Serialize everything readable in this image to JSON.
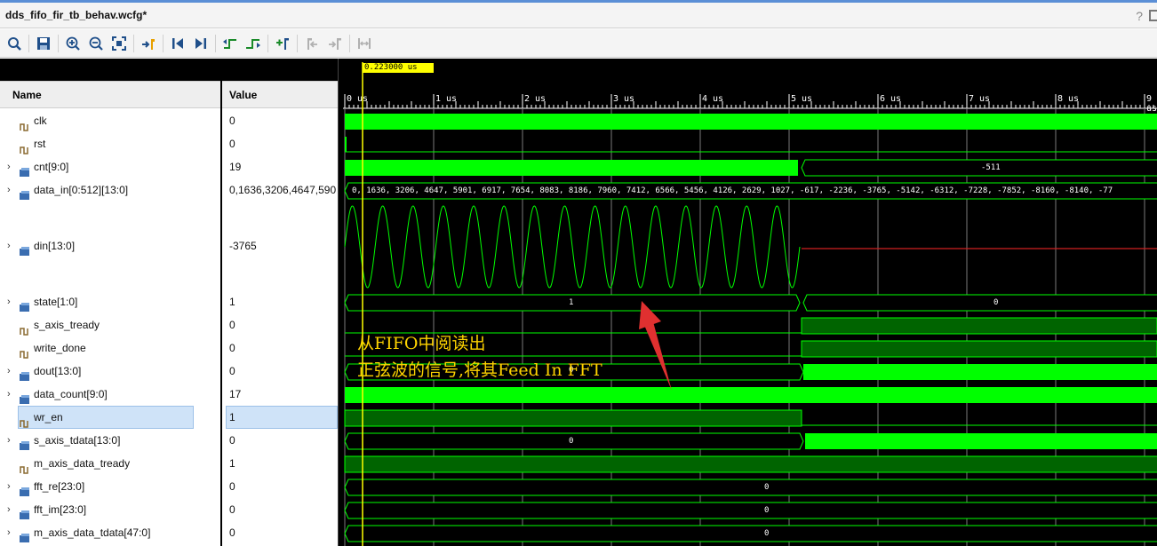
{
  "window": {
    "title": "dds_fifo_fir_tb_behav.wcfg*",
    "help_icon": "?"
  },
  "toolbar": {
    "buttons": [
      "search-icon",
      "save-icon",
      "zoom-in-icon",
      "zoom-out-icon",
      "zoom-fit-icon",
      "goto-cursor-icon",
      "goto-start-icon",
      "goto-end-icon",
      "previous-transition-icon",
      "next-transition-icon",
      "add-marker-icon",
      "previous-marker-icon",
      "next-marker-icon",
      "swap-cursors-icon"
    ]
  },
  "columns": {
    "name": "Name",
    "value": "Value"
  },
  "signals": [
    {
      "name": "clk",
      "value": "0",
      "expandable": false,
      "kind": "bit"
    },
    {
      "name": "rst",
      "value": "0",
      "expandable": false,
      "kind": "bit"
    },
    {
      "name": "cnt[9:0]",
      "value": "19",
      "expandable": true,
      "kind": "bus"
    },
    {
      "name": "data_in[0:512][13:0]",
      "value": "0,1636,3206,4647,590",
      "expandable": true,
      "kind": "bus"
    },
    {
      "name": "din[13:0]",
      "value": "-3765",
      "expandable": true,
      "kind": "bus"
    },
    {
      "name": "state[1:0]",
      "value": "1",
      "expandable": true,
      "kind": "bus"
    },
    {
      "name": "s_axis_tready",
      "value": "0",
      "expandable": false,
      "kind": "bit"
    },
    {
      "name": "write_done",
      "value": "0",
      "expandable": false,
      "kind": "bit"
    },
    {
      "name": "dout[13:0]",
      "value": "0",
      "expandable": true,
      "kind": "bus"
    },
    {
      "name": "data_count[9:0]",
      "value": "17",
      "expandable": true,
      "kind": "bus"
    },
    {
      "name": "wr_en",
      "value": "1",
      "expandable": false,
      "kind": "bit",
      "selected": true
    },
    {
      "name": "s_axis_tdata[13:0]",
      "value": "0",
      "expandable": true,
      "kind": "bus"
    },
    {
      "name": "m_axis_data_tready",
      "value": "1",
      "expandable": false,
      "kind": "bit"
    },
    {
      "name": "fft_re[23:0]",
      "value": "0",
      "expandable": true,
      "kind": "bus"
    },
    {
      "name": "fft_im[23:0]",
      "value": "0",
      "expandable": true,
      "kind": "bus"
    },
    {
      "name": "m_axis_data_tdata[47:0]",
      "value": "0",
      "expandable": true,
      "kind": "bus"
    }
  ],
  "waveform": {
    "cursor_label": "0.223000 us",
    "time_ticks": [
      "0 us",
      "1 us",
      "2 us",
      "3 us",
      "4 us",
      "5 us",
      "6 us",
      "7 us",
      "8 us",
      "9 us"
    ],
    "cnt_after": "-511",
    "data_in_values": "0, 1636, 3206, 4647, 5901, 6917, 7654, 8083, 8186, 7960, 7412, 6566, 5456, 4126, 2629, 1027, -617, -2236, -3765, -5142, -6312, -7228, -7852, -8160, -8140, -77",
    "state_before": "1",
    "state_after": "0",
    "dout_value": "0",
    "tdata_before": "0",
    "fft_re_value": "0",
    "fft_im_value": "0",
    "tdata48_value": "0",
    "annotation_line1": "从FIFO中阅读出",
    "annotation_line2": "正弦波的信号,将其Feed In FFT"
  },
  "colors": {
    "wave": "#00ff00",
    "wave_dark": "#006400",
    "cursor": "#ffff00",
    "annotation": "#ffd400",
    "arrow": "#e03030",
    "selection": "#cfe3f8"
  }
}
